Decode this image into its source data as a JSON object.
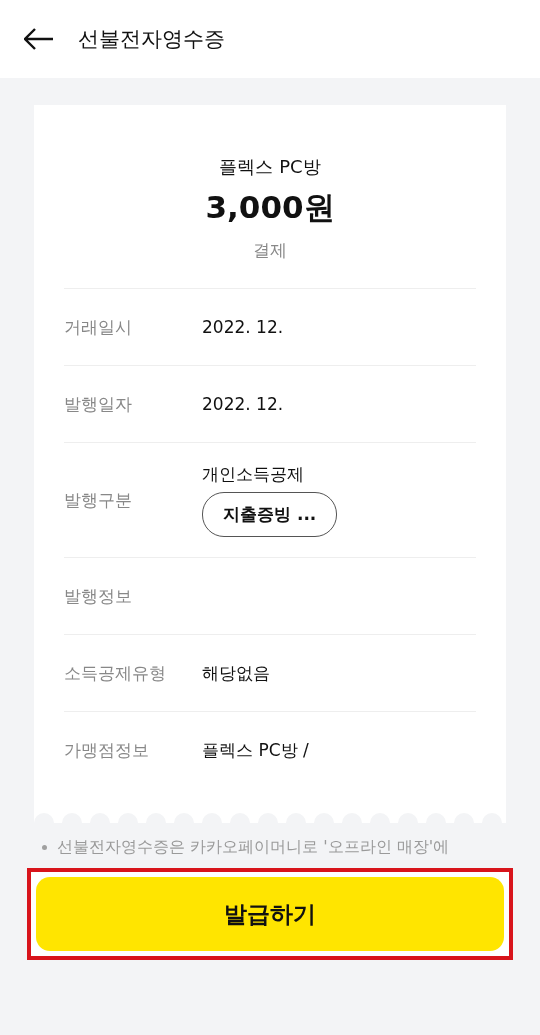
{
  "header": {
    "title": "선불전자영수증"
  },
  "receipt": {
    "store": "플렉스 PC방",
    "amount": "3,000원",
    "status": "결제",
    "rows": [
      {
        "label": "거래일시",
        "value": "2022. 12."
      },
      {
        "label": "발행일자",
        "value": "2022. 12."
      },
      {
        "label": "발행구분",
        "value": "개인소득공제",
        "button": "지출증빙 ..."
      },
      {
        "label": "발행정보"
      },
      {
        "label": "소득공제유형",
        "value": "해당없음"
      },
      {
        "label": "가맹점정보",
        "value": "플렉스 PC방 /"
      }
    ]
  },
  "note": "선불전자영수증은 카카오페이머니로 '오프라인 매장'에",
  "primary_button": {
    "label": "발급하기",
    "highlighted": true
  }
}
